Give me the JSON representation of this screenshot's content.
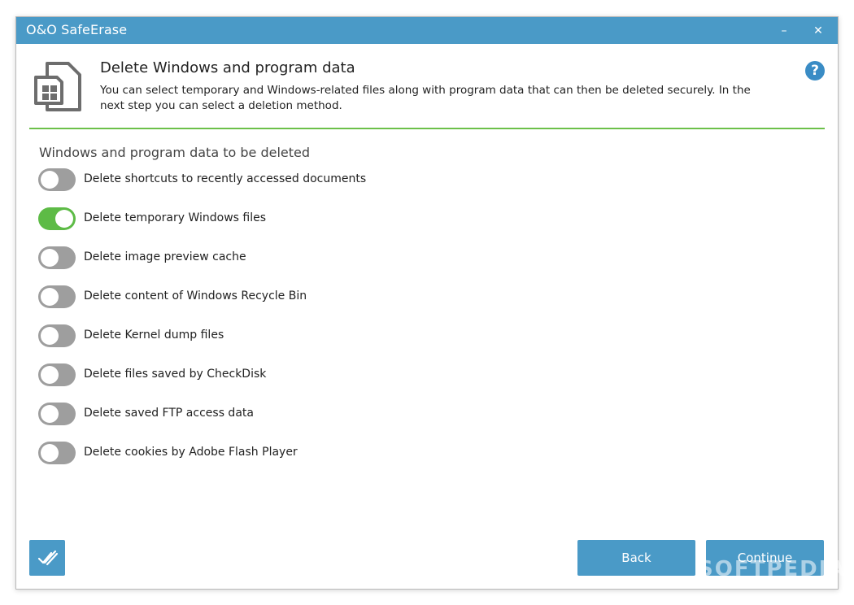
{
  "window": {
    "title": "O&O SafeErase",
    "minimize_glyph": "–",
    "close_glyph": "✕"
  },
  "header": {
    "icon": "document-windows-icon",
    "title": "Delete Windows and program data",
    "description": "You can select temporary and Windows-related files along with program data that can then be deleted securely. In the next step you can select a deletion method.",
    "help_glyph": "?"
  },
  "section": {
    "title": "Windows and program data to be deleted"
  },
  "options": [
    {
      "label": "Delete shortcuts to recently accessed documents",
      "checked": false
    },
    {
      "label": "Delete temporary Windows files",
      "checked": true
    },
    {
      "label": "Delete image preview cache",
      "checked": false
    },
    {
      "label": "Delete content of Windows Recycle Bin",
      "checked": false
    },
    {
      "label": "Delete Kernel dump files",
      "checked": false
    },
    {
      "label": "Delete files saved by CheckDisk",
      "checked": false
    },
    {
      "label": "Delete saved FTP access data",
      "checked": false
    },
    {
      "label": "Delete cookies by Adobe Flash Player",
      "checked": false
    }
  ],
  "footer": {
    "select_all_icon": "double-check-icon",
    "back_label": "Back",
    "continue_label": "Continue"
  },
  "watermark": "SOFTPEDIA",
  "colors": {
    "accent": "#4a9ac7",
    "toggle_on": "#5dbb46",
    "toggle_off": "#9e9e9e",
    "divider": "#6cc04a"
  }
}
